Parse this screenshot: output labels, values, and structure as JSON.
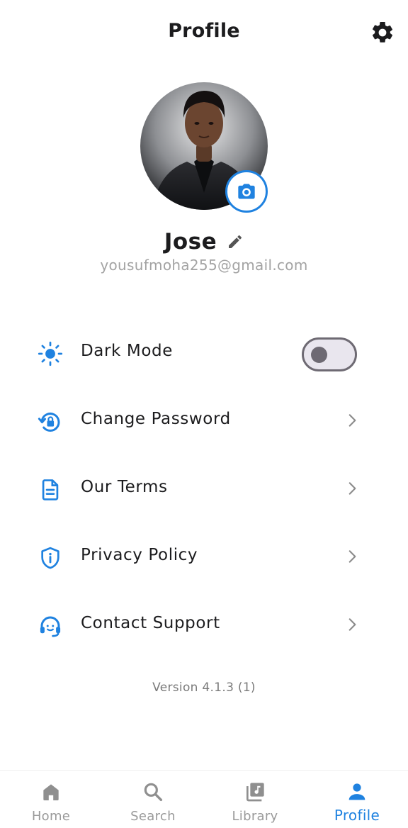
{
  "header": {
    "title": "Profile",
    "settings_icon": "gear-icon"
  },
  "profile": {
    "name": "Jose",
    "email": "yousufmoha255@gmail.com",
    "avatar_icon": "avatar-photo",
    "camera_icon": "camera-icon",
    "edit_icon": "pencil-icon"
  },
  "menu": {
    "items": [
      {
        "label": "Dark Mode",
        "icon": "sun-icon",
        "control": "toggle",
        "toggle_on": false
      },
      {
        "label": "Change Password",
        "icon": "lock-reset-icon",
        "control": "chevron"
      },
      {
        "label": "Our Terms",
        "icon": "document-icon",
        "control": "chevron"
      },
      {
        "label": "Privacy Policy",
        "icon": "shield-info-icon",
        "control": "chevron"
      },
      {
        "label": "Contact Support",
        "icon": "headset-icon",
        "control": "chevron"
      }
    ]
  },
  "version": "Version 4.1.3 (1)",
  "bottom_nav": {
    "items": [
      {
        "label": "Home",
        "icon": "home-icon",
        "active": false
      },
      {
        "label": "Search",
        "icon": "search-icon",
        "active": false
      },
      {
        "label": "Library",
        "icon": "library-icon",
        "active": false
      },
      {
        "label": "Profile",
        "icon": "person-icon",
        "active": true
      }
    ]
  },
  "colors": {
    "accent": "#1f82e0",
    "text": "#1c1c1e",
    "muted": "#a3a3a3",
    "toggle_off": "#6e6a73"
  }
}
